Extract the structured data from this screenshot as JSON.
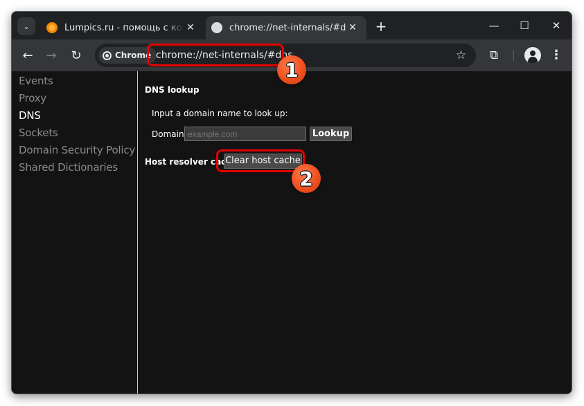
{
  "browser": {
    "tabs": [
      {
        "title": "Lumpics.ru - помощь с компьютером",
        "favicon": "orange-icon",
        "active": false
      },
      {
        "title": "chrome://net-internals/#dns",
        "favicon": "globe-icon",
        "active": true
      }
    ],
    "tab_search_glyph": "⌄",
    "tab_close_glyph": "✕",
    "new_tab_glyph": "+",
    "window_controls": {
      "minimize": "—",
      "maximize": "☐",
      "close": "✕"
    },
    "nav": {
      "back": "←",
      "forward": "→",
      "reload": "↻"
    },
    "chip_label": "Chrome",
    "url": "chrome://net-internals/#dns",
    "star_glyph": "☆",
    "extensions_glyph": "⧉",
    "menu_glyph": "⋮"
  },
  "sidebar": {
    "items": [
      {
        "label": "Events",
        "active": false
      },
      {
        "label": "Proxy",
        "active": false
      },
      {
        "label": "DNS",
        "active": true
      },
      {
        "label": "Sockets",
        "active": false
      },
      {
        "label": "Domain Security Policy",
        "active": false
      },
      {
        "label": "Shared Dictionaries",
        "active": false
      }
    ]
  },
  "dns": {
    "heading": "DNS lookup",
    "prompt": "Input a domain name to look up:",
    "domain_label": "Domain:",
    "domain_value": "",
    "domain_placeholder": "example.com",
    "lookup_button": "Lookup",
    "cache_label": "Host resolver cache",
    "clear_button": "Clear host cache"
  },
  "annotations": {
    "step1": "1",
    "step2": "2",
    "highlight_color": "#e60000",
    "badge_color": "#f0501e"
  }
}
